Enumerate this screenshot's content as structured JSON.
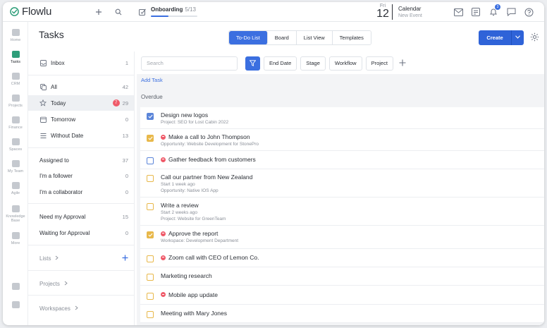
{
  "app": {
    "name": "Flowlu"
  },
  "topbar": {
    "onboarding": {
      "title": "Onboarding",
      "count": "5/13",
      "progress": 0.38
    },
    "calendar": {
      "dow": "Fri",
      "day": "12",
      "title": "Calendar",
      "subtitle": "New Event"
    },
    "notifications_count": "3"
  },
  "leftnav": {
    "items": [
      {
        "label": "Home",
        "icon": "home-icon"
      },
      {
        "label": "Tasks",
        "icon": "tasks-icon",
        "active": true
      },
      {
        "label": "CRM",
        "icon": "crm-icon"
      },
      {
        "label": "Projects",
        "icon": "projects-icon"
      },
      {
        "label": "Finance",
        "icon": "finance-icon"
      },
      {
        "label": "Spaces",
        "icon": "spaces-icon"
      },
      {
        "label": "My Team",
        "icon": "team-icon"
      },
      {
        "label": "Agile",
        "icon": "agile-icon"
      },
      {
        "label": "Knowledge Base",
        "icon": "knowledge-base-icon"
      },
      {
        "label": "More",
        "icon": "more-icon"
      }
    ]
  },
  "header": {
    "title": "Tasks",
    "tabs": [
      "To-Do List",
      "Board",
      "List View",
      "Templates"
    ],
    "active_tab": 0,
    "create_label": "Create"
  },
  "sidebar": {
    "inbox": {
      "label": "Inbox",
      "count": "1"
    },
    "all": {
      "label": "All",
      "count": "42"
    },
    "today": {
      "label": "Today",
      "badge": "7",
      "count": "29"
    },
    "tomorrow": {
      "label": "Tomorrow",
      "count": "0"
    },
    "without_date": {
      "label": "Without Date",
      "count": "13"
    },
    "assigned_to": {
      "label": "Assigned to",
      "count": "37"
    },
    "follower": {
      "label": "I'm a follower",
      "count": "0"
    },
    "collaborator": {
      "label": "I'm a collaborator",
      "count": "0"
    },
    "need_approval": {
      "label": "Need my Approval",
      "count": "15"
    },
    "waiting_approval": {
      "label": "Waiting for Approval",
      "count": "0"
    },
    "lists": {
      "label": "Lists"
    },
    "projects": {
      "label": "Projects"
    },
    "workspaces": {
      "label": "Workspaces"
    }
  },
  "filters": {
    "search_placeholder": "Search",
    "chips": [
      "End Date",
      "Stage",
      "Workflow",
      "Project"
    ]
  },
  "tasks": {
    "add_label": "Add Task",
    "group_label": "Overdue",
    "items": [
      {
        "title": "Design new logos",
        "subtitle": "Project: SEO for Lost Cabin 2022",
        "priority": false,
        "check": "checked-blue"
      },
      {
        "title": "Make a call to John Thompson",
        "subtitle": "Opportunity: Website Development for StonePro",
        "priority": true,
        "check": "checked-yellow"
      },
      {
        "title": "Gather feedback from customers",
        "subtitle": "",
        "priority": true,
        "check": "blue"
      },
      {
        "title": "Call our partner from New Zealand",
        "subtitle": "Start 1 week ago",
        "subtitle2": "Opportunity: Native IOS App",
        "priority": false,
        "check": "yellow"
      },
      {
        "title": "Write a review",
        "subtitle": "Start 2 weeks ago",
        "subtitle2": "Project: Website for GreenTeam",
        "priority": false,
        "check": "yellow"
      },
      {
        "title": "Approve the report",
        "subtitle": "Workspace: Development Department",
        "priority": true,
        "check": "checked-yellow"
      },
      {
        "title": "Zoom call with CEO of Lemon Co.",
        "subtitle": "",
        "priority": true,
        "check": "yellow"
      },
      {
        "title": "Marketing research",
        "subtitle": "",
        "priority": false,
        "check": "yellow"
      },
      {
        "title": "Mobile app update",
        "subtitle": "",
        "priority": true,
        "check": "yellow"
      },
      {
        "title": "Meeting with Mary Jones",
        "subtitle": "",
        "priority": false,
        "check": "yellow"
      }
    ]
  },
  "colors": {
    "accent": "#3b6fe0",
    "brand": "#2e9e7a",
    "priority": "#ef5b6a",
    "task_checkbox": "#e8b84a"
  }
}
